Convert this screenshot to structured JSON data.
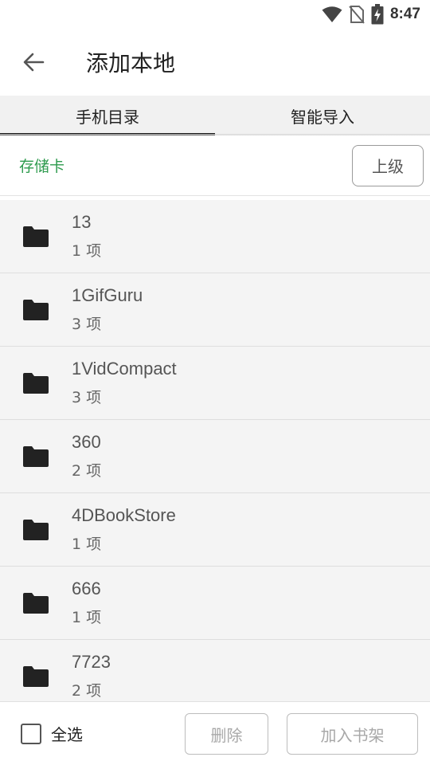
{
  "status_bar": {
    "time": "8:47",
    "icons": [
      "wifi-icon",
      "no-sim-icon",
      "battery-charging-icon"
    ]
  },
  "app_bar": {
    "title": "添加本地",
    "back_icon": "arrow-left-icon"
  },
  "tabs": [
    {
      "label": "手机目录",
      "active": true
    },
    {
      "label": "智能导入",
      "active": false
    }
  ],
  "path_bar": {
    "current": "存储卡",
    "up_label": "上级",
    "accent_color": "#2e9b4e"
  },
  "folders": [
    {
      "name": "13",
      "count": "1 项"
    },
    {
      "name": "1GifGuru",
      "count": "3 项"
    },
    {
      "name": "1VidCompact",
      "count": "3 项"
    },
    {
      "name": "360",
      "count": "2 项"
    },
    {
      "name": "4DBookStore",
      "count": "1 项"
    },
    {
      "name": "666",
      "count": "1 项"
    },
    {
      "name": "7723",
      "count": "2 项"
    }
  ],
  "bottom_bar": {
    "select_all_label": "全选",
    "select_all_checked": false,
    "delete_label": "删除",
    "add_label": "加入书架"
  }
}
